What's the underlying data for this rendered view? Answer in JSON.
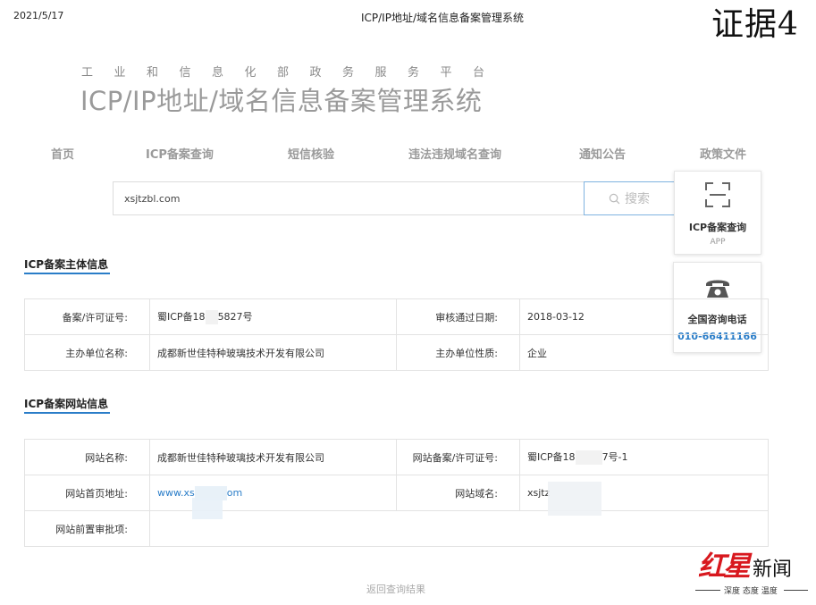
{
  "print_header": {
    "date": "2021/5/17",
    "title": "ICP/IP地址/域名信息备案管理系统",
    "evidence_mark": "证据4"
  },
  "header": {
    "ministry": "工业和信息化部政务服务平台",
    "system_title": "ICP/IP地址/域名信息备案管理系统"
  },
  "nav": {
    "items": [
      "首页",
      "ICP备案查询",
      "短信核验",
      "违法违规域名查询",
      "通知公告",
      "政策文件"
    ]
  },
  "search": {
    "value": "xsjtzbl.com",
    "button_label": "搜索"
  },
  "side_cards": {
    "app": {
      "title": "ICP备案查询",
      "subtitle": "APP",
      "icon": "qr-scan-icon"
    },
    "phone": {
      "title": "全国咨询电话",
      "number": "010-66411166",
      "icon": "telephone-icon"
    }
  },
  "subject_section": {
    "title": "ICP备案主体信息",
    "rows": [
      {
        "label1": "备案/许可证号:",
        "value1_pre": "蜀ICP备18",
        "value1_post": "5827号",
        "label2": "审核通过日期:",
        "value2": "2018-03-12"
      },
      {
        "label1": "主办单位名称:",
        "value1": "成都新世佳特种玻璃技术开发有限公司",
        "label2": "主办单位性质:",
        "value2": "企业"
      }
    ]
  },
  "website_section": {
    "title": "ICP备案网站信息",
    "rows": [
      {
        "label1": "网站名称:",
        "value1": "成都新世佳特种玻璃技术开发有限公司",
        "label2": "网站备案/许可证号:",
        "value2_pre": "蜀ICP备18",
        "value2_post": "7号-1"
      },
      {
        "label1": "网站首页地址:",
        "value1_pre": "www.xs",
        "value1_post": "om",
        "label2": "网站域名:",
        "value2": "xsjtz"
      },
      {
        "label1": "网站前置审批项:",
        "value1": ""
      }
    ]
  },
  "footer": {
    "back_link": "返回查询结果"
  },
  "watermark": {
    "brand_hong": "红",
    "brand_xing": "星",
    "brand_news": "新闻",
    "slogan": "深度 态度 温度"
  },
  "colors": {
    "accent": "#2a7dc8",
    "brand_red": "#d8181e",
    "muted_text": "#9a9a9a"
  }
}
